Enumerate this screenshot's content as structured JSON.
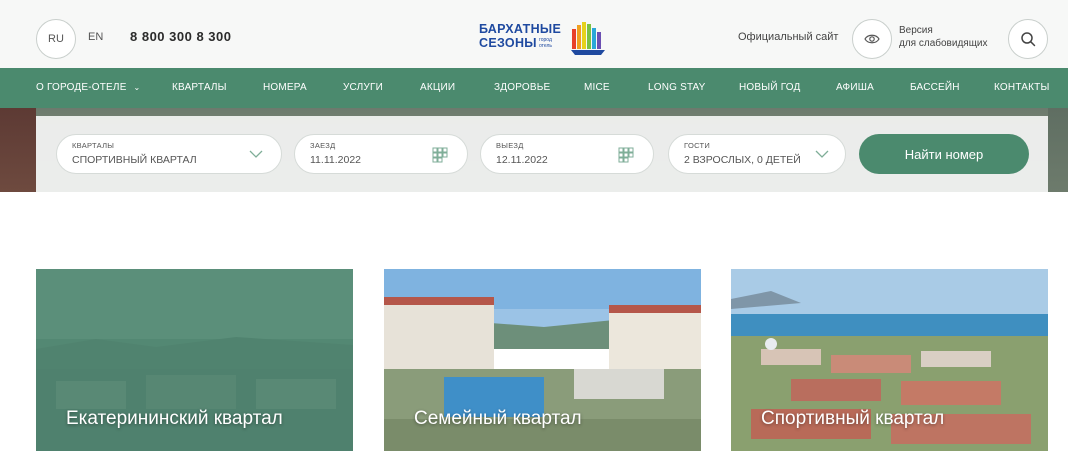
{
  "header": {
    "lang_ru": "RU",
    "lang_en": "EN",
    "phone": "8 800 300 8 300",
    "logo_line1": "БАРХАТНЫЕ",
    "logo_line2": "СЕЗОНЫ",
    "logo_small": "город отель",
    "official_site": "Официальный сайт",
    "vision_line1": "Версия",
    "vision_line2": "для слабовидящих"
  },
  "nav": {
    "items": [
      "О ГОРОДЕ-ОТЕЛЕ",
      "КВАРТАЛЫ",
      "НОМЕРА",
      "УСЛУГИ",
      "АКЦИИ",
      "ЗДОРОВЬЕ",
      "MICE",
      "LONG STAY",
      "НОВЫЙ ГОД",
      "АФИША",
      "БАССЕЙН",
      "КОНТАКТЫ"
    ]
  },
  "booking": {
    "district_label": "КВАРТАЛЫ",
    "district_value": "СПОРТИВНЫЙ КВАРТАЛ",
    "checkin_label": "ЗАЕЗД",
    "checkin_value": "11.11.2022",
    "checkout_label": "ВЫЕЗД",
    "checkout_value": "12.11.2022",
    "guests_label": "ГОСТИ",
    "guests_value": "2 ВЗРОСЛЫХ, 0 ДЕТЕЙ",
    "find_button": "Найти номер"
  },
  "cards": [
    {
      "label": "Екатерининский квартал"
    },
    {
      "label": "Семейный квартал"
    },
    {
      "label": "Спортивный квартал"
    }
  ],
  "colors": {
    "brand_green": "#4b8a6e",
    "logo_blue": "#1f4aa0"
  }
}
